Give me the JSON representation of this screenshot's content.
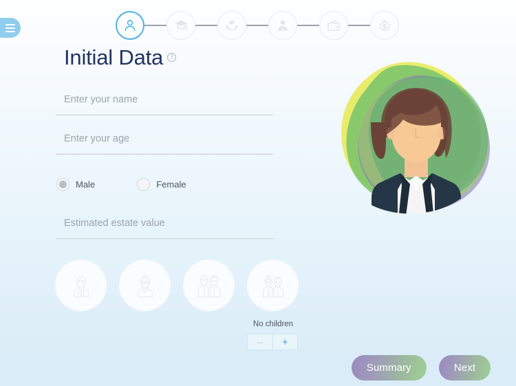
{
  "menu": {
    "icon": "hamburger-menu-icon",
    "label": "Menu"
  },
  "stepper": {
    "steps": [
      {
        "icon": "person-icon",
        "name": "personal-data",
        "active": true
      },
      {
        "icon": "graduation-cap-icon",
        "name": "education",
        "active": false
      },
      {
        "icon": "hands-plant-icon",
        "name": "health",
        "active": false
      },
      {
        "icon": "businessman-icon",
        "name": "career",
        "active": false
      },
      {
        "icon": "wallet-icon",
        "name": "spending",
        "active": false
      },
      {
        "icon": "money-bag-icon",
        "name": "savings",
        "active": false
      }
    ]
  },
  "header": {
    "title": "Initial Data",
    "help_icon": "question-mark-icon",
    "help_glyph": "?"
  },
  "form": {
    "name_placeholder": "Enter your name",
    "name_value": "",
    "age_placeholder": "Enter your age",
    "age_value": "",
    "estate_placeholder": "Estimated estate value",
    "estate_value": "",
    "gender": {
      "selected": "Male",
      "options": [
        {
          "label": "Male",
          "checked": true
        },
        {
          "label": "Female",
          "checked": false
        }
      ]
    }
  },
  "family": {
    "options": [
      {
        "name": "single-male",
        "icon": "elderly-man-icon"
      },
      {
        "name": "single-female",
        "icon": "elderly-woman-icon"
      },
      {
        "name": "couple",
        "icon": "couple-icon"
      },
      {
        "name": "couple-with-kids",
        "icon": "children-couple-icon"
      }
    ],
    "children_label": "No children",
    "children_count": "0",
    "minus_label": "–",
    "plus_label": "+"
  },
  "illustration": {
    "name": "female-avatar-illustration",
    "blob_colors": [
      "#e9e94f",
      "#6ec16a",
      "#8f7fb5",
      "#a9d06c",
      "#58b070"
    ]
  },
  "actions": {
    "summary_label": "Summary",
    "next_label": "Next"
  },
  "colors": {
    "accent_blue": "#4db3e0",
    "title_navy": "#243461",
    "menu_blue": "#8fcdee",
    "button_gradient_start": "#9b89c0",
    "button_gradient_end": "#9ed093"
  }
}
